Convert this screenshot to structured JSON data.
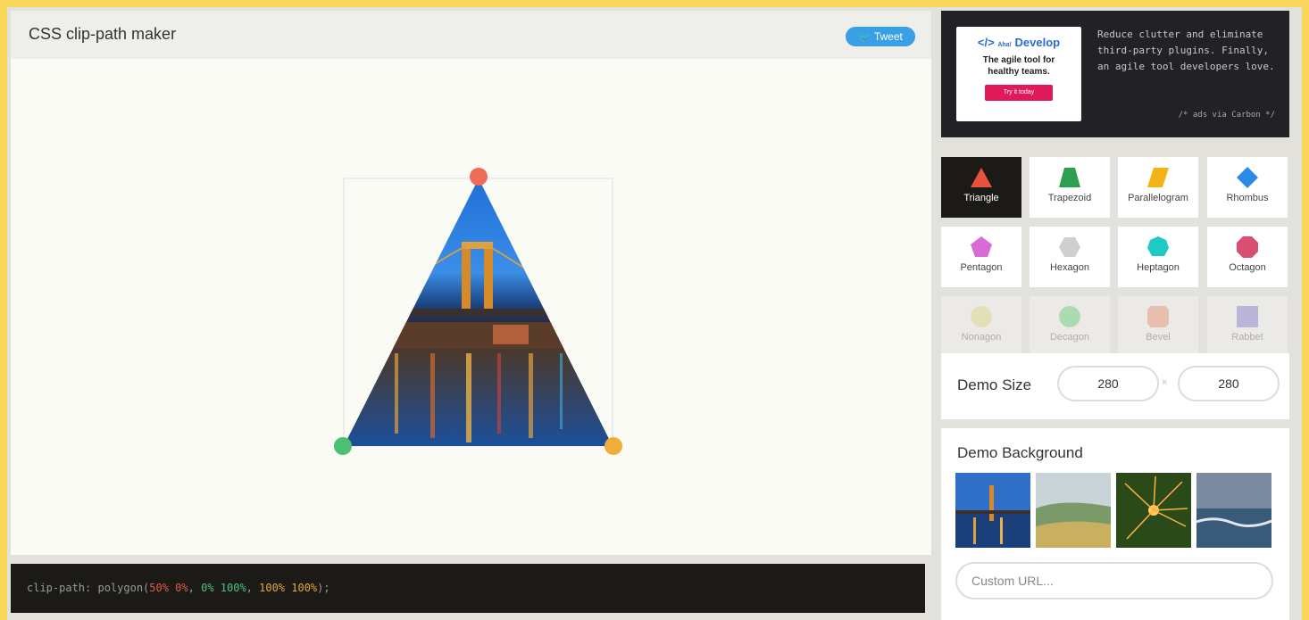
{
  "header": {
    "title": "CSS clip-path maker",
    "tweet_label": "Tweet"
  },
  "code": {
    "prefix": "clip-path: polygon(",
    "p1": "50% 0%",
    "p2": "0% 100%",
    "p3": "100% 100%",
    "suffix": ");"
  },
  "ad": {
    "brand_small": "Aha!",
    "brand": "Develop",
    "tagline_1": "The agile tool for",
    "tagline_2": "healthy teams.",
    "cta": "Try it today",
    "text": "Reduce clutter and eliminate third-party plugins. Finally, an agile tool developers love.",
    "via": "/* ads via Carbon */"
  },
  "shapes": [
    {
      "label": "Triangle",
      "color": "#e8533a",
      "icon": "triangle-icon",
      "active": true
    },
    {
      "label": "Trapezoid",
      "color": "#2e9e4f",
      "icon": "trapezoid-icon"
    },
    {
      "label": "Parallelogram",
      "color": "#f3b216",
      "icon": "parallelogram-icon"
    },
    {
      "label": "Rhombus",
      "color": "#2a8ae6",
      "icon": "rhombus-icon"
    },
    {
      "label": "Pentagon",
      "color": "#d96bd6",
      "icon": "pentagon-icon"
    },
    {
      "label": "Hexagon",
      "color": "#cfcfcf",
      "icon": "hexagon-icon"
    },
    {
      "label": "Heptagon",
      "color": "#1fc9c4",
      "icon": "heptagon-icon"
    },
    {
      "label": "Octagon",
      "color": "#d94f72",
      "icon": "octagon-icon"
    },
    {
      "label": "Nonagon",
      "color": "#e6e072",
      "icon": "nonagon-icon",
      "faded": true
    },
    {
      "label": "Decagon",
      "color": "#3fcf5a",
      "icon": "decagon-icon",
      "faded": true
    },
    {
      "label": "Bevel",
      "color": "#f07a4a",
      "icon": "bevel-icon",
      "faded": true
    },
    {
      "label": "Rabbet",
      "color": "#6a5ad6",
      "icon": "rabbet-icon",
      "faded": true
    }
  ],
  "demo_size": {
    "label": "Demo Size",
    "width": "280",
    "height": "280",
    "separator": "×"
  },
  "demo_background": {
    "label": "Demo Background",
    "thumbnails": [
      "bridge-night",
      "green-hills",
      "sparkler",
      "ocean-waves"
    ],
    "custom_url_placeholder": "Custom URL..."
  },
  "handles": {
    "top": "#ee6b57",
    "bottom_left": "#4dbf73",
    "bottom_right": "#f0ad3a"
  }
}
